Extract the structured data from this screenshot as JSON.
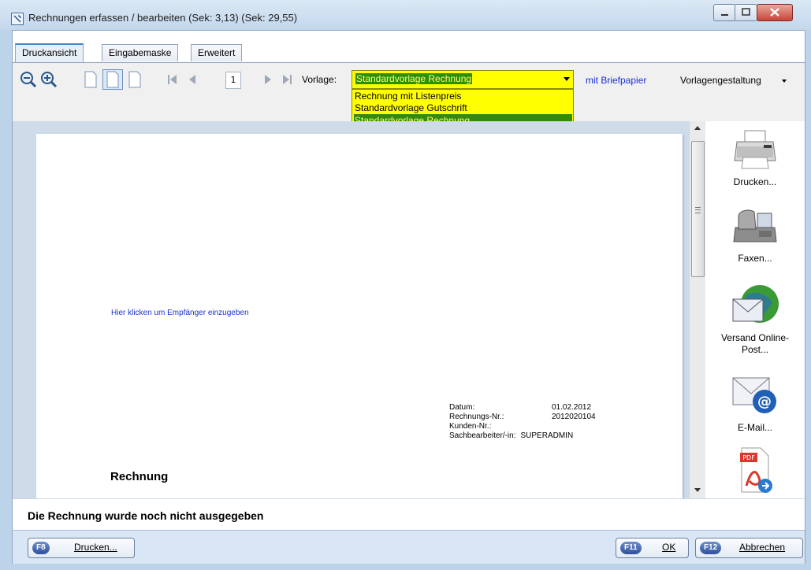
{
  "window": {
    "title": "Rechnungen erfassen / bearbeiten (Sek: 3,13) (Sek: 29,55)"
  },
  "tabs": [
    {
      "label": "Druckansicht",
      "active": true
    },
    {
      "label": "Eingabemaske",
      "active": false
    },
    {
      "label": "Erweitert",
      "active": false
    }
  ],
  "toolbar": {
    "page_number": "1",
    "vorlage_label": "Vorlage:",
    "vorlage_selected": "Standardvorlage Rechnung",
    "vorlage_options": [
      "Rechnung mit Listenpreis",
      "Standardvorlage Gutschrift",
      "Standardvorlage Rechnung"
    ],
    "briefpapier_link": "mit Briefpapier",
    "vorlagengestaltung_label": "Vorlagengestaltung"
  },
  "document": {
    "recipient_hint": "Hier klicken um Empfänger einzugeben",
    "info": [
      {
        "label": "Datum:",
        "value": "01.02.2012"
      },
      {
        "label": "Rechnungs-Nr.:",
        "value": "2012020104"
      },
      {
        "label": "Kunden-Nr.:",
        "value": ""
      },
      {
        "label": "Sachbearbeiter/-in:",
        "value": "SUPERADMIN"
      }
    ],
    "title": "Rechnung"
  },
  "actions": {
    "print": "Drucken...",
    "fax": "Faxen...",
    "online_post": "Versand Online-Post...",
    "email": "E-Mail..."
  },
  "status": {
    "message": "Die Rechnung wurde noch nicht ausgegeben"
  },
  "buttons": {
    "print": {
      "key": "F8",
      "label": "Drucken..."
    },
    "ok": {
      "key": "F11",
      "label": "OK"
    },
    "cancel": {
      "key": "F12",
      "label": "Abbrechen"
    }
  },
  "colors": {
    "combo_background": "#ffff00",
    "combo_selection": "#2e8d0b",
    "link": "#1a2fd6"
  }
}
